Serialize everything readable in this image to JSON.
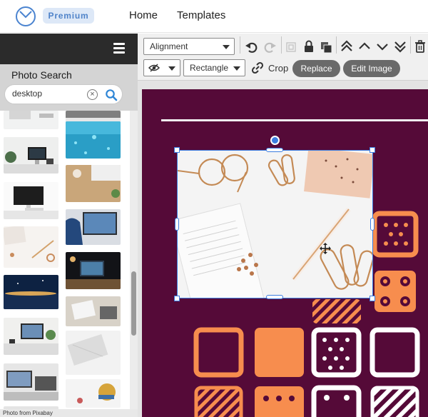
{
  "header": {
    "premium_label": "Premium",
    "nav": [
      {
        "label": "Home"
      },
      {
        "label": "Templates"
      }
    ]
  },
  "sidebar": {
    "title": "Photo Search",
    "search": {
      "value": "desktop",
      "clear_symbol": "×"
    },
    "credit_prefix": "Photo from ",
    "credit_source": "Pixabay",
    "photos": [
      {
        "col": 0,
        "desc": "desk top strip",
        "colors": [
          "#eef0f0",
          "#c9c9c9"
        ]
      },
      {
        "col": 1,
        "desc": "keyboard top strip",
        "colors": [
          "#e6e6e6",
          "#8a8a8a"
        ]
      },
      {
        "col": 0,
        "desc": "imac with plant",
        "colors": [
          "#f2f2f2",
          "#1c1c1c"
        ]
      },
      {
        "col": 1,
        "desc": "water droplets",
        "colors": [
          "#2e9dc4",
          "#5fd0ea"
        ]
      },
      {
        "col": 0,
        "desc": "white imac desk",
        "colors": [
          "#fafafa",
          "#2b2b2b"
        ]
      },
      {
        "col": 1,
        "desc": "keyboard on wood",
        "colors": [
          "#c9a77a",
          "#e8e8e8"
        ]
      },
      {
        "col": 0,
        "desc": "paper and paperclips",
        "colors": [
          "#f5f3f1",
          "#c98c5d"
        ]
      },
      {
        "col": 1,
        "desc": "person at computer",
        "colors": [
          "#4a77a8",
          "#d9dde3"
        ]
      },
      {
        "col": 0,
        "desc": "night sky",
        "colors": [
          "#0f2545",
          "#d9a657"
        ]
      },
      {
        "col": 1,
        "desc": "dark desk lamp",
        "colors": [
          "#15161a",
          "#7b5d3a"
        ]
      },
      {
        "col": 0,
        "desc": "imac desk with plant",
        "colors": [
          "#f0f0ee",
          "#3a3a3a"
        ]
      },
      {
        "col": 1,
        "desc": "laptop and notebook",
        "colors": [
          "#d8d2c8",
          "#fafafa"
        ]
      },
      {
        "col": 0,
        "desc": "laptop desk",
        "colors": [
          "#6e6e6e",
          "#e7e7e7"
        ]
      },
      {
        "col": 1,
        "desc": "white keyboard",
        "colors": [
          "#f0f0f0",
          "#cccccc"
        ]
      },
      {
        "col": 0,
        "desc": "bottom strip",
        "colors": [
          "#e9e9e9",
          "#888888"
        ]
      },
      {
        "col": 1,
        "desc": "colorful tools",
        "colors": [
          "#f4f4f4",
          "#d6a43a"
        ]
      }
    ]
  },
  "toolbar": {
    "alignment": "Alignment",
    "shape": "Rectangle",
    "crop": "Crop",
    "replace": "Replace",
    "edit_image": "Edit Image"
  },
  "canvas": {
    "background": "#550a38",
    "accent_orange": "#f78d4e",
    "white": "#ffffff"
  }
}
